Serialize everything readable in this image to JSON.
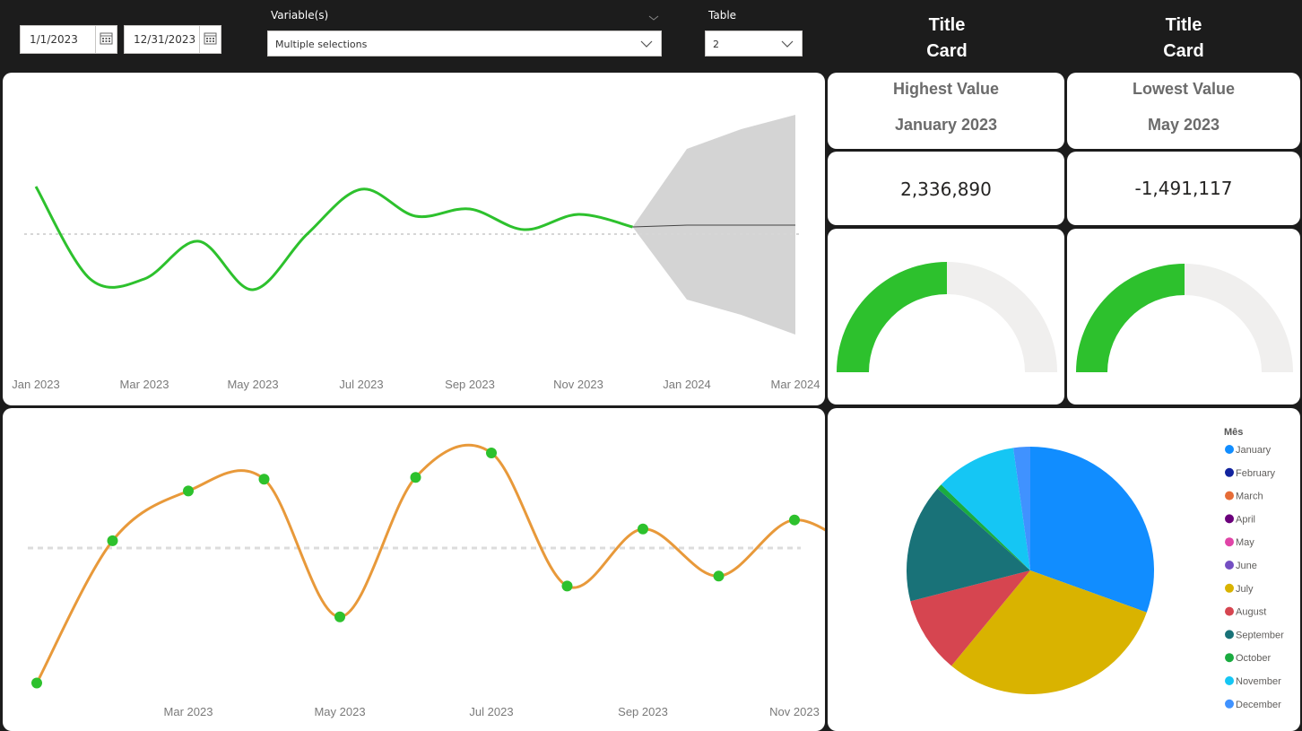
{
  "filters": {
    "start_date": "1/1/2023",
    "end_date": "12/31/2023",
    "variable_label": "Variable(s)",
    "variable_value": "Multiple selections",
    "table_label": "Table",
    "table_value": "2"
  },
  "title_cards": [
    {
      "line1": "Title",
      "line2": "Card"
    },
    {
      "line1": "Title",
      "line2": "Card"
    }
  ],
  "kpis": {
    "highest": {
      "title": "Highest Value",
      "period": "January 2023",
      "value": "2,336,890",
      "gauge_fraction": 0.5
    },
    "lowest": {
      "title": "Lowest Value",
      "period": "May 2023",
      "value": "-1,491,117",
      "gauge_fraction": 0.5
    }
  },
  "colors": {
    "forecast_line": "#2dc12d",
    "forecast_band": "#d4d4d4",
    "orange_line": "#e8993a",
    "marker": "#2dc12d",
    "gauge_fill": "#2dc12d",
    "gauge_track": "#f0efee"
  },
  "chart_data": [
    {
      "type": "line",
      "x_ticks": [
        "Jan 2023",
        "Mar 2023",
        "May 2023",
        "Jul 2023",
        "Sep 2023",
        "Nov 2023",
        "Jan 2024",
        "Mar 2024"
      ],
      "series": [
        {
          "x": [
            "Jan 2023",
            "Feb 2023",
            "Mar 2023",
            "Apr 2023",
            "May 2023",
            "Jun 2023",
            "Jul 2023",
            "Aug 2023",
            "Sep 2023",
            "Oct 2023",
            "Nov 2023",
            "Dec 2023"
          ],
          "values": [
            0.53,
            -0.5,
            -0.5,
            -0.08,
            -0.62,
            0.0,
            0.5,
            0.2,
            0.28,
            0.05,
            0.22,
            0.08
          ]
        }
      ],
      "forecast": {
        "x": [
          "Dec 2023",
          "Jan 2024",
          "Feb 2024",
          "Mar 2024"
        ],
        "values": [
          0.08,
          0.1,
          0.1,
          0.1
        ],
        "upper": [
          0.08,
          0.95,
          1.17,
          1.33
        ],
        "lower": [
          0.08,
          -0.73,
          -0.9,
          -1.12
        ]
      },
      "reference_line": 0,
      "ylim": [
        -1.6,
        1.6
      ]
    },
    {
      "type": "line",
      "x_ticks": [
        "Mar 2023",
        "May 2023",
        "Jul 2023",
        "Sep 2023",
        "Nov 2023"
      ],
      "series": [
        {
          "x": [
            "Jan 2023",
            "Feb 2023",
            "Mar 2023",
            "Apr 2023",
            "May 2023",
            "Jun 2023",
            "Jul 2023",
            "Aug 2023",
            "Sep 2023",
            "Oct 2023",
            "Nov 2023",
            "Dec 2023"
          ],
          "values": [
            -1.49,
            0.08,
            0.63,
            0.76,
            -0.76,
            0.78,
            1.05,
            -0.42,
            0.21,
            -0.31,
            0.31,
            -0.16
          ]
        }
      ],
      "reference_line": 0,
      "ylim": [
        -1.6,
        1.3
      ]
    },
    {
      "type": "pie",
      "legend_title": "Mês",
      "legend_position": "right",
      "slices": [
        {
          "label": "January",
          "value": 30.5,
          "color": "#118dff"
        },
        {
          "label": "February",
          "value": 0,
          "color": "#12239e"
        },
        {
          "label": "March",
          "value": 0,
          "color": "#e66c37"
        },
        {
          "label": "April",
          "value": 0,
          "color": "#6b007b"
        },
        {
          "label": "May",
          "value": 0,
          "color": "#e044a7"
        },
        {
          "label": "June",
          "value": 0,
          "color": "#744ec2"
        },
        {
          "label": "July",
          "value": 30.5,
          "color": "#d9b300"
        },
        {
          "label": "August",
          "value": 10.0,
          "color": "#d64550"
        },
        {
          "label": "September",
          "value": 15.5,
          "color": "#197278"
        },
        {
          "label": "October",
          "value": 0.7,
          "color": "#1aab40"
        },
        {
          "label": "November",
          "value": 10.6,
          "color": "#15c6f4"
        },
        {
          "label": "December",
          "value": 2.2,
          "color": "#4092ff"
        }
      ]
    }
  ]
}
